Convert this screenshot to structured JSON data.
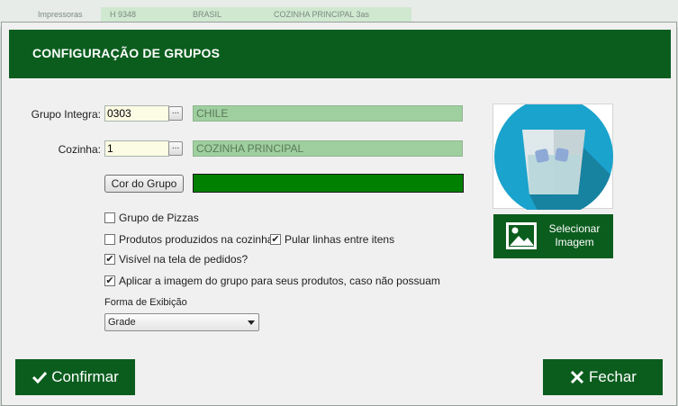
{
  "background": {
    "cells": [
      "Impressoras",
      "H 9348",
      "BRASIL",
      "COZINHA PRINCIPAL 3as"
    ]
  },
  "dialog": {
    "title": "CONFIGURAÇÃO DE GRUPOS"
  },
  "form": {
    "grupo_integra_label": "Grupo Integra:",
    "grupo_integra_code": "0303",
    "grupo_integra_name": "CHILE",
    "cozinha_label": "Cozinha:",
    "cozinha_code": "1",
    "cozinha_name": "COZINHA PRINCIPAL",
    "lookup_button": "...",
    "cor_do_grupo_button": "Cor do Grupo",
    "group_color": "#008000"
  },
  "checkboxes": {
    "grupo_pizzas": {
      "label": "Grupo de Pizzas",
      "checked": false
    },
    "produtos_cozinha": {
      "label": "Produtos produzidos na cozinha",
      "checked": false
    },
    "pular_linhas": {
      "label": "Pular linhas entre itens",
      "checked": true
    },
    "visivel_pedidos": {
      "label": "Visível na tela de pedidos?",
      "checked": true
    },
    "aplicar_imagem": {
      "label": "Aplicar a imagem do grupo para seus produtos, caso não possuam",
      "checked": true
    }
  },
  "exibicao": {
    "label": "Forma de Exibição",
    "selected": "Grade"
  },
  "image_panel": {
    "button_label_line1": "Selecionar",
    "button_label_line2": "Imagem"
  },
  "footer": {
    "confirm_label": "Confirmar",
    "close_label": "Fechar"
  },
  "colors": {
    "brand_green": "#0b5d1e",
    "readonly_green": "#9fcf9f",
    "input_yellow": "#fcfce4",
    "icon_blue": "#1aa3cc"
  }
}
